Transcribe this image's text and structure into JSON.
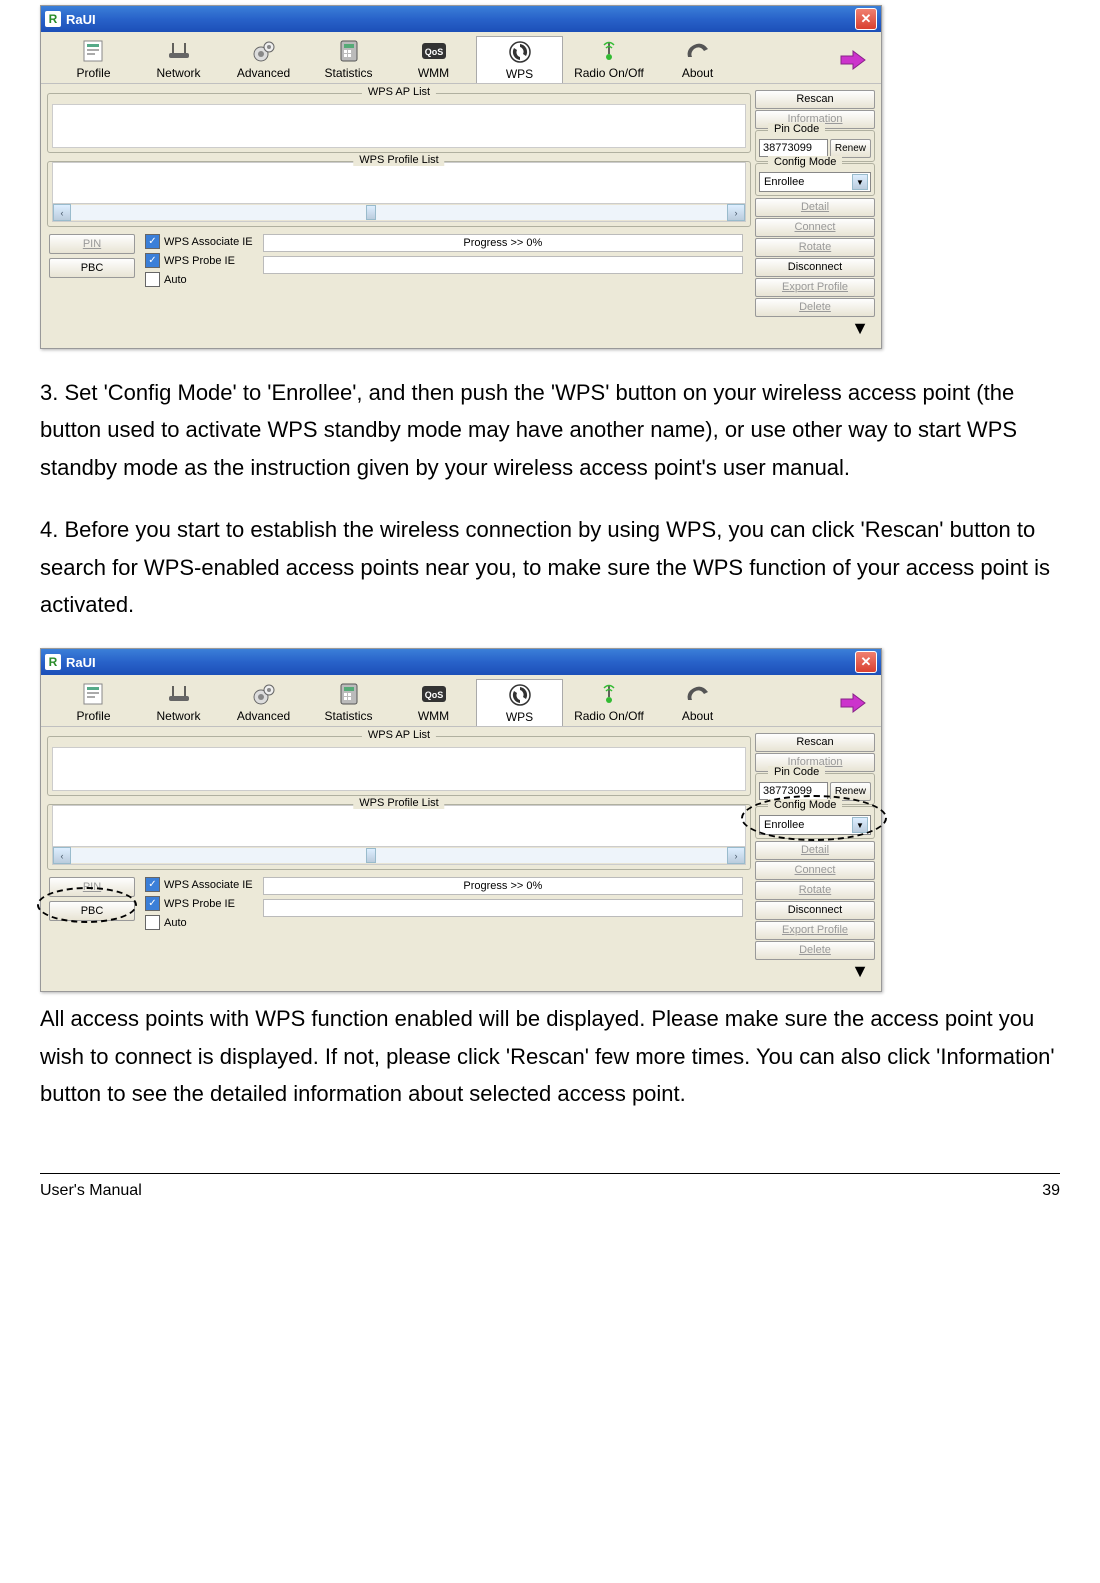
{
  "footer": {
    "left": "User's Manual",
    "right": "39"
  },
  "paragraphs": {
    "p3": "3. Set 'Config Mode' to 'Enrollee', and then push the 'WPS' button on your wireless access point (the button used to activate WPS standby mode may have another name), or use other way to start WPS standby mode as the instruction given by your wireless access point's user manual.",
    "p4": "4. Before you start to establish the wireless connection by using WPS, you can click 'Rescan' button to search for WPS-enabled access points near you, to make sure the WPS function of your access point is activated.",
    "p5": "All access points with WPS function enabled will be displayed. Please make sure the access point you wish to connect is displayed. If not, please click 'Rescan' few more times. You can also click 'Information' button to see the detailed information about selected access point."
  },
  "app": {
    "title": "RaUI",
    "iconLetter": "R",
    "toolbar": {
      "profile": "Profile",
      "network": "Network",
      "advanced": "Advanced",
      "statistics": "Statistics",
      "wmm": "WMM",
      "wps": "WPS",
      "radio": "Radio On/Off",
      "about": "About"
    },
    "sections": {
      "wpsApList": "WPS AP List",
      "wpsProfileList": "WPS Profile List",
      "pinCode": "Pin Code",
      "configMode": "Config Mode"
    },
    "buttons": {
      "pin": "PIN",
      "pbc": "PBC",
      "rescan": "Rescan",
      "information": "Information",
      "renew": "Renew",
      "detail": "Detail",
      "connect": "Connect",
      "rotate": "Rotate",
      "disconnect": "Disconnect",
      "exportProfile": "Export Profile",
      "delete": "Delete"
    },
    "checkboxes": {
      "wpsAssociate": "WPS Associate IE",
      "wpsProbe": "WPS Probe IE",
      "auto": "Auto"
    },
    "progress": "Progress >> 0%",
    "pinValue": "38773099",
    "configModeValue": "Enrollee"
  }
}
